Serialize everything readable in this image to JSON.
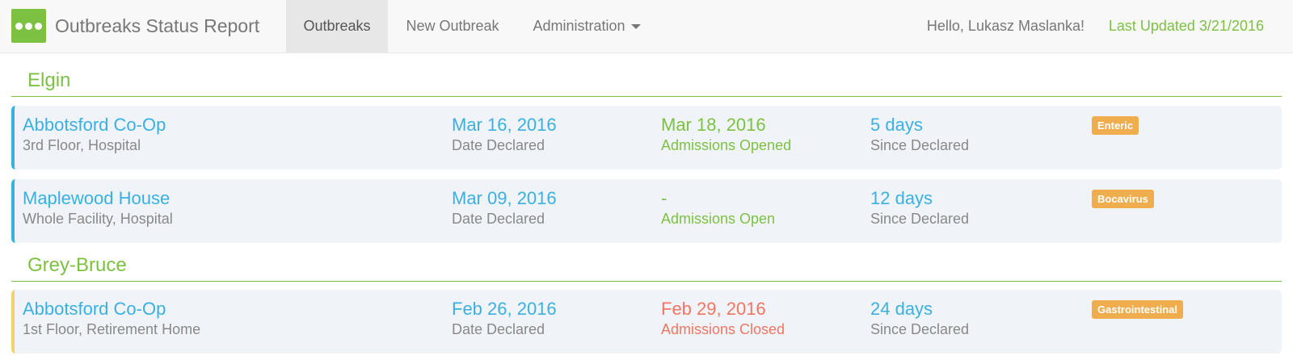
{
  "header": {
    "brand_name": "Outbreaks Status Report",
    "nav": [
      {
        "label": "Outbreaks"
      },
      {
        "label": "New Outbreak"
      },
      {
        "label": "Administration"
      }
    ],
    "greeting": "Hello, Lukasz Maslanka!",
    "last_updated": "Last Updated 3/21/2016"
  },
  "groups": [
    {
      "name": "Elgin",
      "rows": [
        {
          "facility": "Abbotsford Co-Op",
          "location": "3rd Floor, Hospital",
          "declared_date": "Mar 16, 2016",
          "declared_label": "Date Declared",
          "admissions_date": "Mar 18, 2016",
          "admissions_label": "Admissions Opened",
          "since_value": "5 days",
          "since_label": "Since Declared",
          "tag": "Enteric"
        },
        {
          "facility": "Maplewood House",
          "location": "Whole Facility, Hospital",
          "declared_date": "Mar 09, 2016",
          "declared_label": "Date Declared",
          "admissions_date": "-",
          "admissions_label": "Admissions Open",
          "since_value": "12 days",
          "since_label": "Since Declared",
          "tag": "Bocavirus"
        }
      ]
    },
    {
      "name": "Grey-Bruce",
      "rows": [
        {
          "facility": "Abbotsford Co-Op",
          "location": "1st Floor, Retirement Home",
          "declared_date": "Feb 26, 2016",
          "declared_label": "Date Declared",
          "admissions_date": "Feb 29, 2016",
          "admissions_label": "Admissions Closed",
          "since_value": "24 days",
          "since_label": "Since Declared",
          "tag": "Gastrointestinal"
        }
      ]
    }
  ],
  "colors": {
    "brand_green": "#7dc142",
    "link_blue": "#3ab0e2",
    "closed_red": "#f07562",
    "tag_orange": "#f0ad4e",
    "row_background": "#f0f4f9"
  },
  "icons": {
    "brand": "three-dots-icon",
    "admin_menu": "caret-down-icon"
  }
}
